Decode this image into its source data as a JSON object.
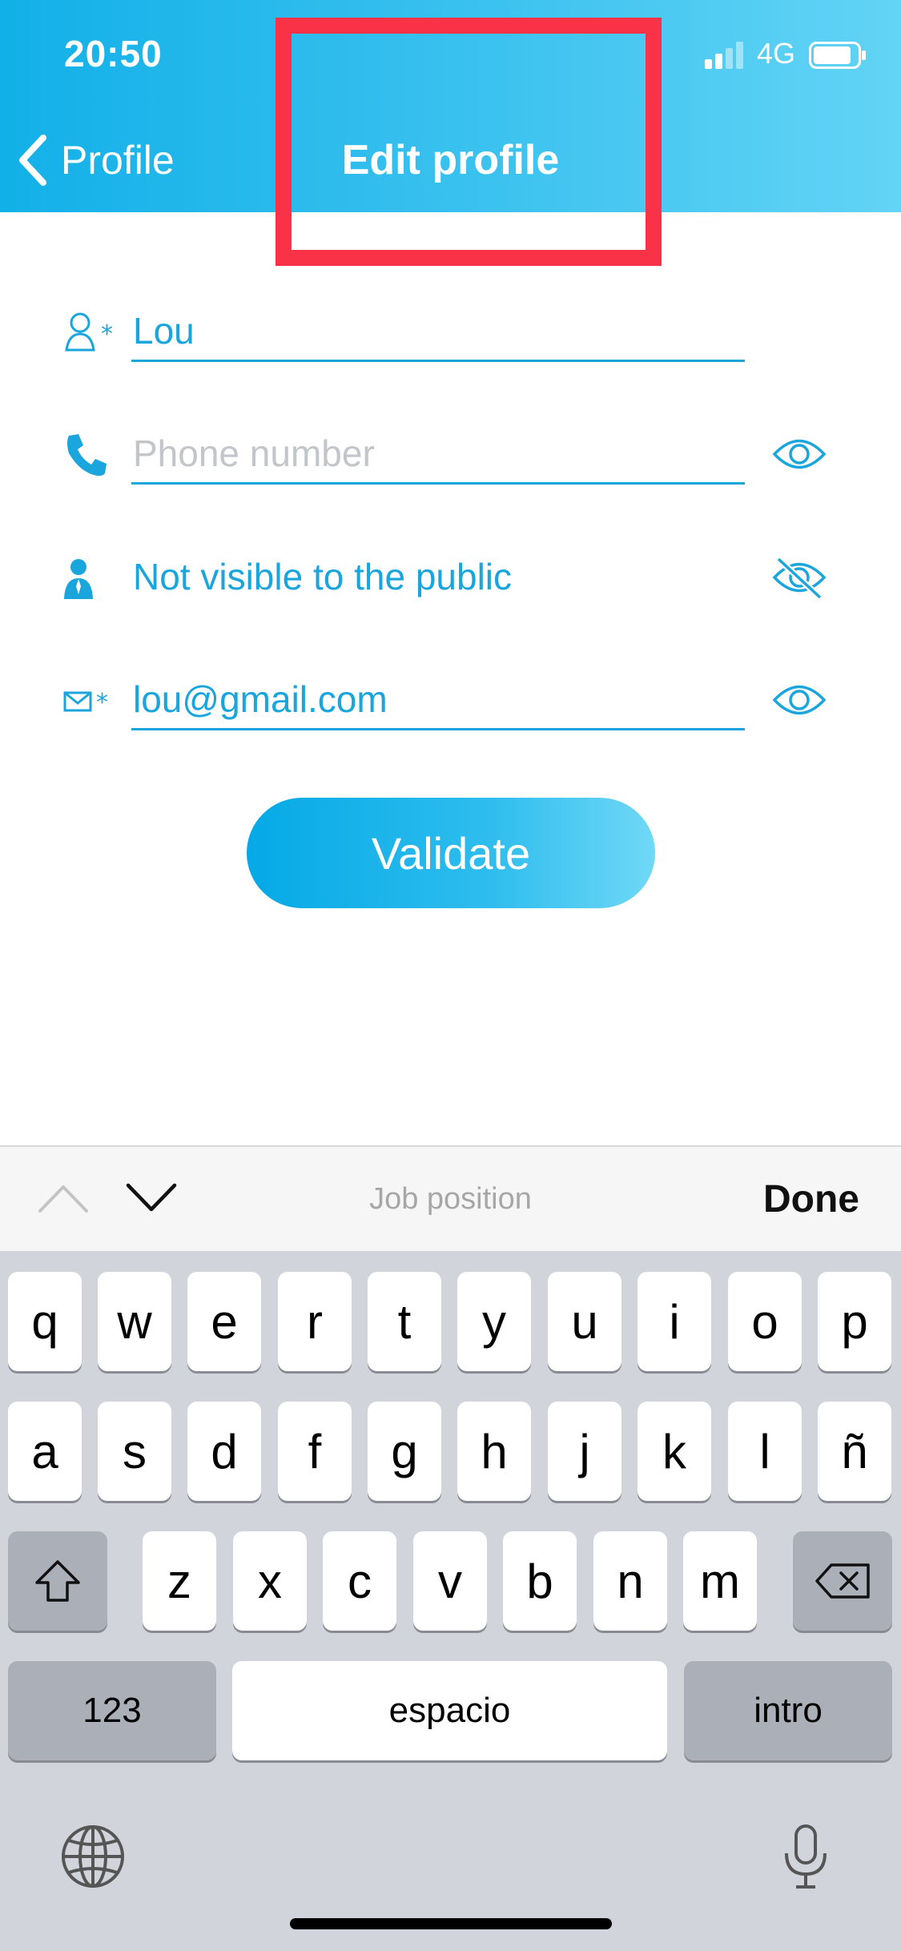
{
  "status_bar": {
    "time": "20:50",
    "network": "4G"
  },
  "header": {
    "back_label": "Profile",
    "title": "Edit profile"
  },
  "form": {
    "name_value": "Lou",
    "phone_placeholder": "Phone number",
    "job_visibility_text": "Not visible to the public",
    "email_value": "lou@gmail.com",
    "validate_label": "Validate"
  },
  "accessory": {
    "field_label": "Job position",
    "done_label": "Done"
  },
  "keyboard": {
    "row1": [
      "q",
      "w",
      "e",
      "r",
      "t",
      "y",
      "u",
      "i",
      "o",
      "p"
    ],
    "row2": [
      "a",
      "s",
      "d",
      "f",
      "g",
      "h",
      "j",
      "k",
      "l",
      "ñ"
    ],
    "row3": [
      "z",
      "x",
      "c",
      "v",
      "b",
      "n",
      "m"
    ],
    "numbers_label": "123",
    "space_label": "espacio",
    "return_label": "intro"
  },
  "colors": {
    "accent": "#1aa5dc",
    "highlight": "#fa3247"
  },
  "icons": [
    "back-chevron-icon",
    "person-icon",
    "phone-icon",
    "user-badge-icon",
    "mail-icon",
    "eye-icon",
    "eye-slash-icon",
    "chevron-up-icon",
    "chevron-down-icon",
    "shift-icon",
    "delete-icon",
    "globe-icon",
    "microphone-icon"
  ]
}
